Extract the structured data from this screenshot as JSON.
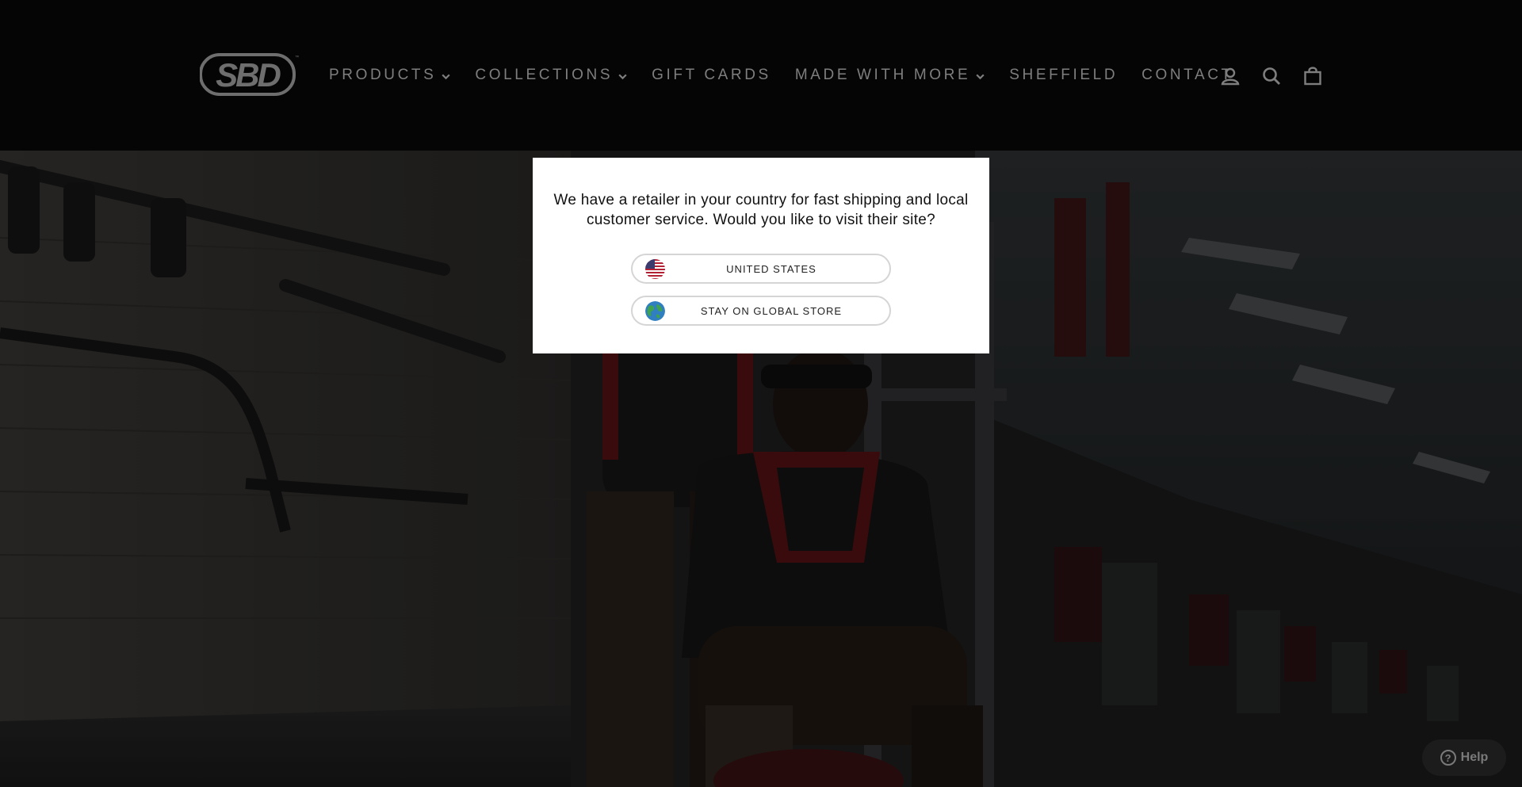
{
  "header": {
    "logo_text": "SBD",
    "nav": [
      {
        "label": "PRODUCTS",
        "has_dropdown": true
      },
      {
        "label": "COLLECTIONS",
        "has_dropdown": true
      },
      {
        "label": "GIFT CARDS",
        "has_dropdown": false
      },
      {
        "label": "MADE WITH MORE",
        "has_dropdown": true
      },
      {
        "label": "SHEFFIELD",
        "has_dropdown": false
      },
      {
        "label": "CONTACT",
        "has_dropdown": false
      }
    ],
    "icons": [
      "account-icon",
      "search-icon",
      "cart-icon"
    ]
  },
  "modal": {
    "message": "We have a retailer in your country for fast shipping and local customer service. Would you like to visit their site?",
    "options": [
      {
        "label": "UNITED STATES",
        "icon": "us-flag-icon"
      },
      {
        "label": "STAY ON GLOBAL STORE",
        "icon": "globe-icon"
      }
    ]
  },
  "help": {
    "label": "Help"
  },
  "colors": {
    "header_bg": "#050505",
    "nav_text": "#7e7e7e",
    "modal_bg": "#ffffff",
    "accent_red": "#a01a1f"
  }
}
